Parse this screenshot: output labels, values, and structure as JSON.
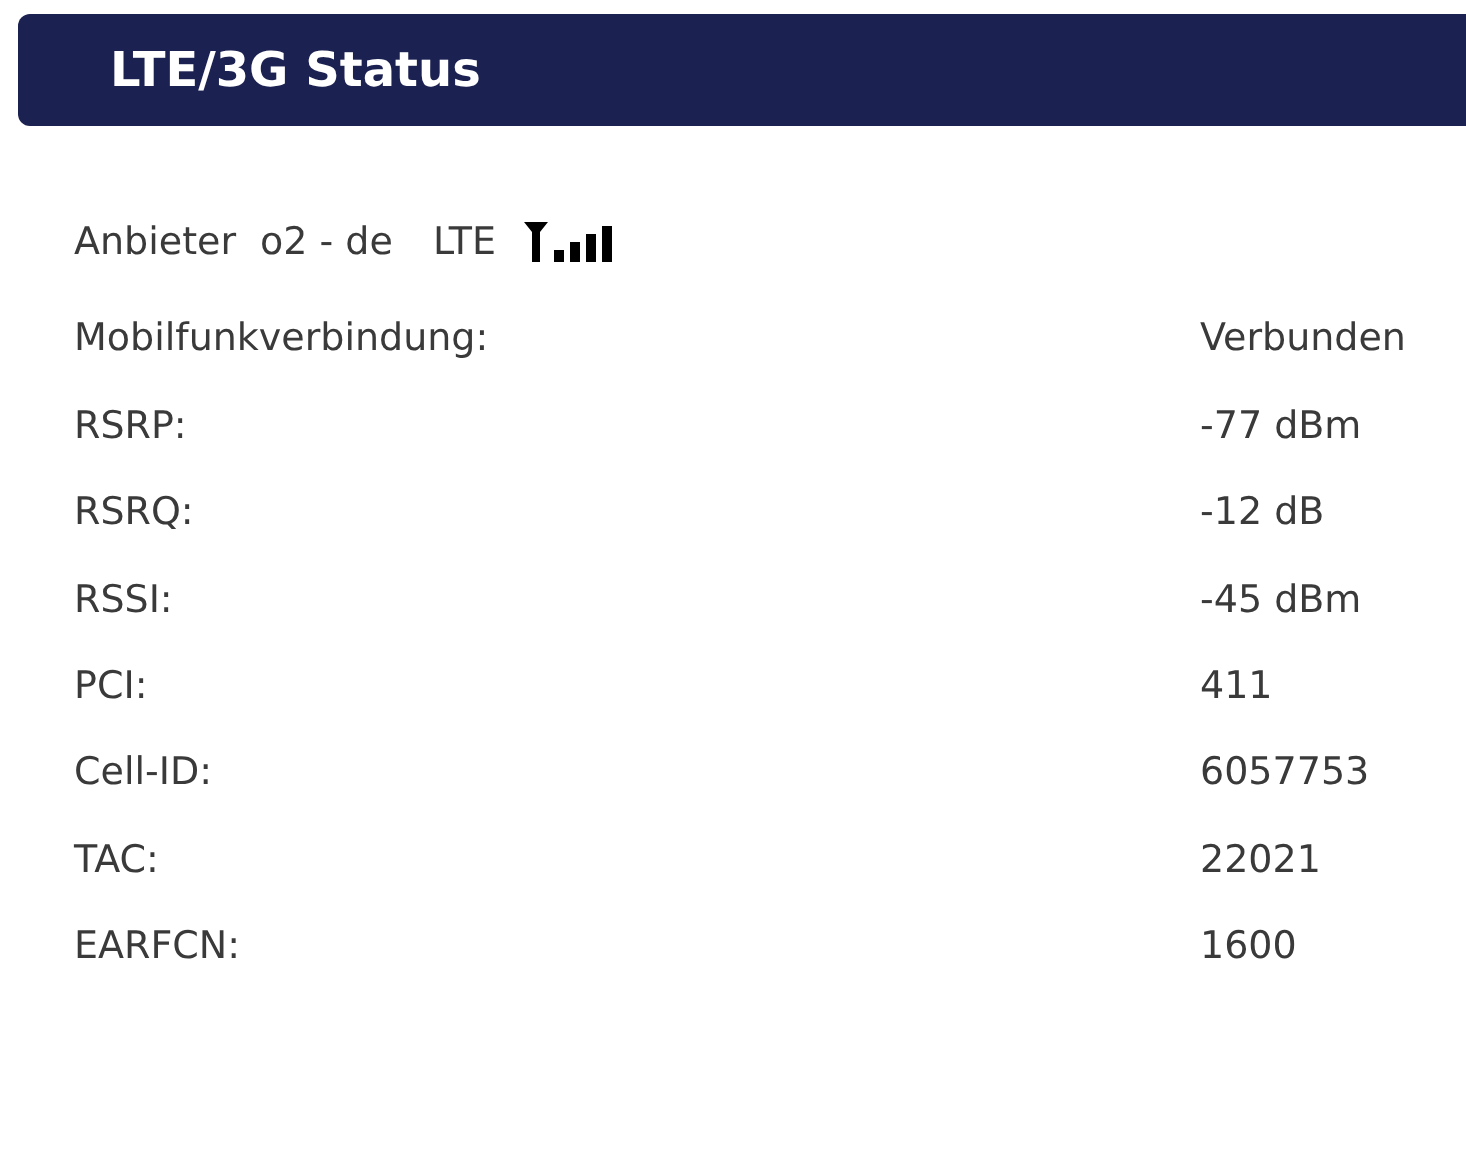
{
  "header": {
    "title": "LTE/3G Status"
  },
  "provider": {
    "label": "Anbieter",
    "name": "o2 - de",
    "network": "LTE"
  },
  "rows": [
    {
      "label": "Mobilfunkverbindung:",
      "value": "Verbunden"
    },
    {
      "label": "RSRP:",
      "value": "-77 dBm"
    },
    {
      "label": "RSRQ:",
      "value": "-12 dB"
    },
    {
      "label": "RSSI:",
      "value": "-45 dBm"
    },
    {
      "label": "PCI:",
      "value": "411"
    },
    {
      "label": "Cell-ID:",
      "value": "6057753"
    },
    {
      "label": "TAC:",
      "value": "22021"
    },
    {
      "label": "EARFCN:",
      "value": "1600"
    }
  ]
}
